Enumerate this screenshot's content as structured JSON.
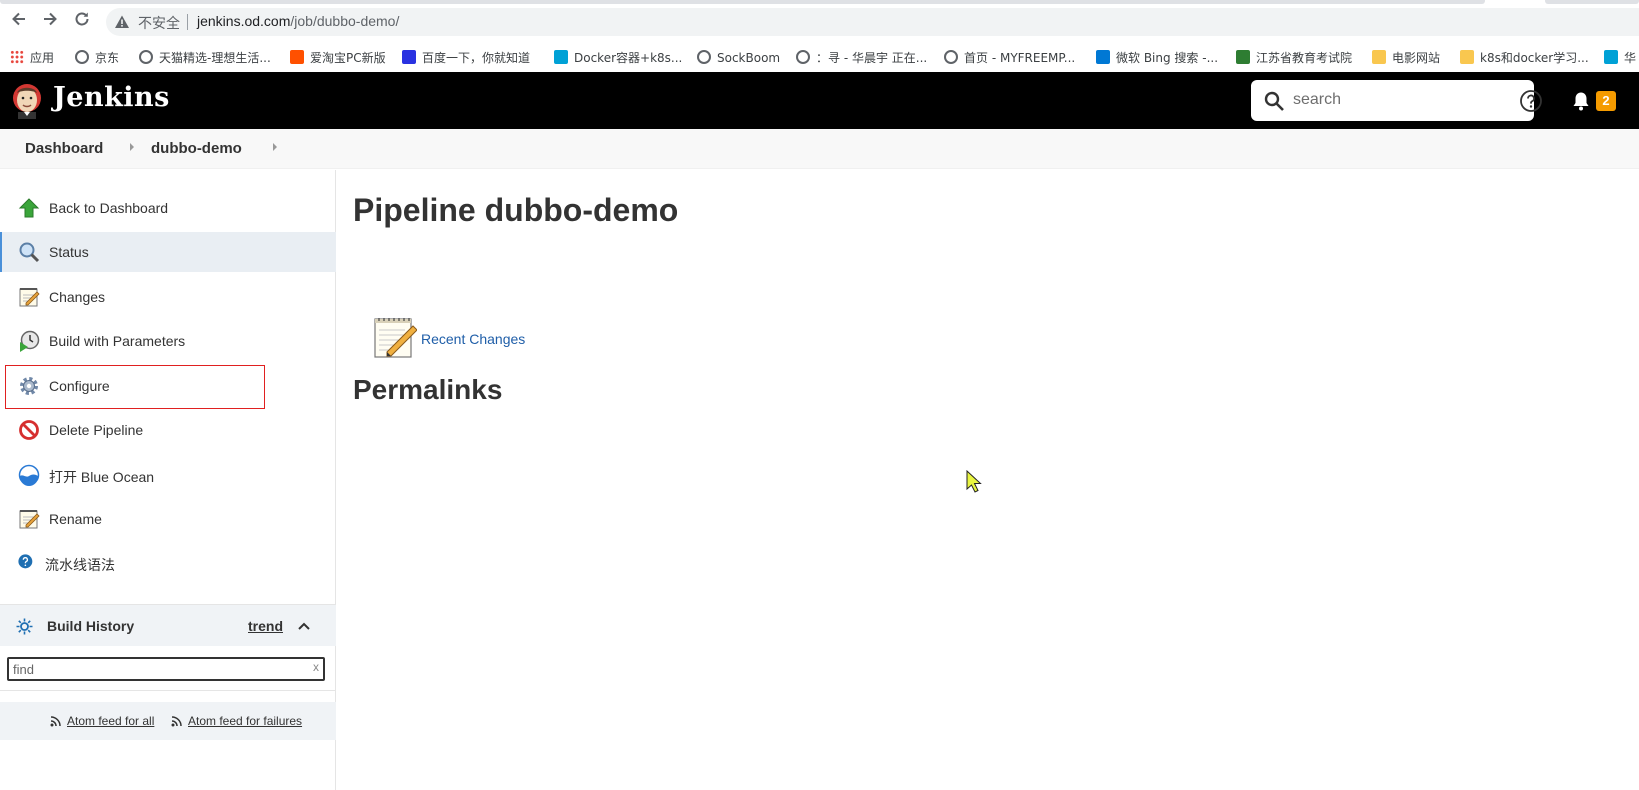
{
  "browser": {
    "insecure_label": "不安全",
    "url_host": "jenkins.od.com",
    "url_path": "/job/dubbo-demo/",
    "bookmarks": [
      {
        "label": "应用",
        "icon": "apps-grid-icon",
        "color": "#e8453c"
      },
      {
        "label": "京东",
        "icon": "globe-icon",
        "color": "#5f6368"
      },
      {
        "label": "天猫精选-理想生活...",
        "icon": "globe-icon",
        "color": "#5f6368"
      },
      {
        "label": "爱淘宝PC新版",
        "icon": "taobao-icon",
        "color": "#ff5000"
      },
      {
        "label": "百度一下，你就知道",
        "icon": "baidu-paw-icon",
        "color": "#2932e1"
      },
      {
        "label": "Docker容器+k8s...",
        "icon": "bilibili-tv-icon",
        "color": "#00a1d6"
      },
      {
        "label": "SockBoom",
        "icon": "robot-icon",
        "color": "#5f6368"
      },
      {
        "label": "：寻 - 华晨宇 正在...",
        "icon": "music-note-icon",
        "color": "#5f6368"
      },
      {
        "label": "首页 - MYFREEMP...",
        "icon": "globe-icon",
        "color": "#5f6368"
      },
      {
        "label": "微软 Bing 搜索 -...",
        "icon": "bing-icon",
        "color": "#0078d4"
      },
      {
        "label": "江苏省教育考试院",
        "icon": "shield-leaf-icon",
        "color": "#2e7d32"
      },
      {
        "label": "电影网站",
        "icon": "folder-icon",
        "color": "#f9c74f"
      },
      {
        "label": "k8s和docker学习...",
        "icon": "folder-icon",
        "color": "#f9c74f"
      },
      {
        "label": "华",
        "icon": "bilibili-tv-icon",
        "color": "#00a1d6"
      }
    ]
  },
  "header": {
    "brand": "Jenkins",
    "search_placeholder": "search",
    "notification_count": "2"
  },
  "breadcrumbs": [
    {
      "label": "Dashboard"
    },
    {
      "label": "dubbo-demo"
    }
  ],
  "tasks": [
    {
      "label": "Back to Dashboard",
      "icon": "up-arrow-icon"
    },
    {
      "label": "Status",
      "icon": "magnifier-icon"
    },
    {
      "label": "Changes",
      "icon": "notepad-icon"
    },
    {
      "label": "Build with Parameters",
      "icon": "clock-play-icon"
    },
    {
      "label": "Configure",
      "icon": "gear-icon"
    },
    {
      "label": "Delete Pipeline",
      "icon": "no-entry-icon"
    },
    {
      "label": "打开 Blue Ocean",
      "icon": "blue-ocean-icon"
    },
    {
      "label": "Rename",
      "icon": "notepad-icon"
    },
    {
      "label": "流水线语法",
      "icon": "help-circle-icon"
    }
  ],
  "build_history": {
    "title": "Build History",
    "trend": "trend",
    "find_placeholder": "find",
    "clear": "x",
    "feed_all": "Atom feed for all",
    "feed_failures": "Atom feed for failures"
  },
  "main": {
    "title": "Pipeline dubbo-demo",
    "recent_changes": "Recent Changes",
    "permalinks": "Permalinks"
  }
}
